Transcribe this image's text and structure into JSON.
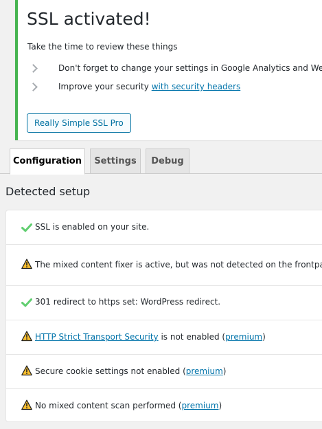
{
  "notice": {
    "title": "SSL activated!",
    "intro": "Take the time to review these things",
    "items": [
      {
        "text": "Don't forget to change your settings in Google Analytics and Webmaster tools."
      },
      {
        "text": "Improve your security ",
        "link": "with security headers"
      }
    ],
    "button_label": "Really Simple SSL Pro",
    "accent_color": "#46b450"
  },
  "tabs": [
    {
      "label": "Configuration",
      "active": true
    },
    {
      "label": "Settings",
      "active": false
    },
    {
      "label": "Debug",
      "active": false
    }
  ],
  "setup": {
    "title": "Detected setup",
    "items": [
      {
        "status": "ok",
        "icon": "check-icon",
        "text": "SSL is enabled on your site."
      },
      {
        "status": "warning",
        "icon": "warning-icon",
        "text": "The mixed content fixer is active, but was not detected on the frontpage."
      },
      {
        "status": "ok",
        "icon": "check-icon",
        "text": "301 redirect to https set: WordPress redirect."
      },
      {
        "status": "warning",
        "icon": "warning-icon",
        "link": "HTTP Strict Transport Security",
        "text": " is not enabled (",
        "premium": "premium",
        "suffix": ")"
      },
      {
        "status": "warning",
        "icon": "warning-icon",
        "text": "Secure cookie settings not enabled (",
        "premium": "premium",
        "suffix": ")"
      },
      {
        "status": "warning",
        "icon": "warning-icon",
        "text": "No mixed content scan performed (",
        "premium": "premium",
        "suffix": ")"
      }
    ]
  },
  "colors": {
    "ok": "#61ce70",
    "warning": "#f8be2e",
    "link": "#0073aa"
  }
}
